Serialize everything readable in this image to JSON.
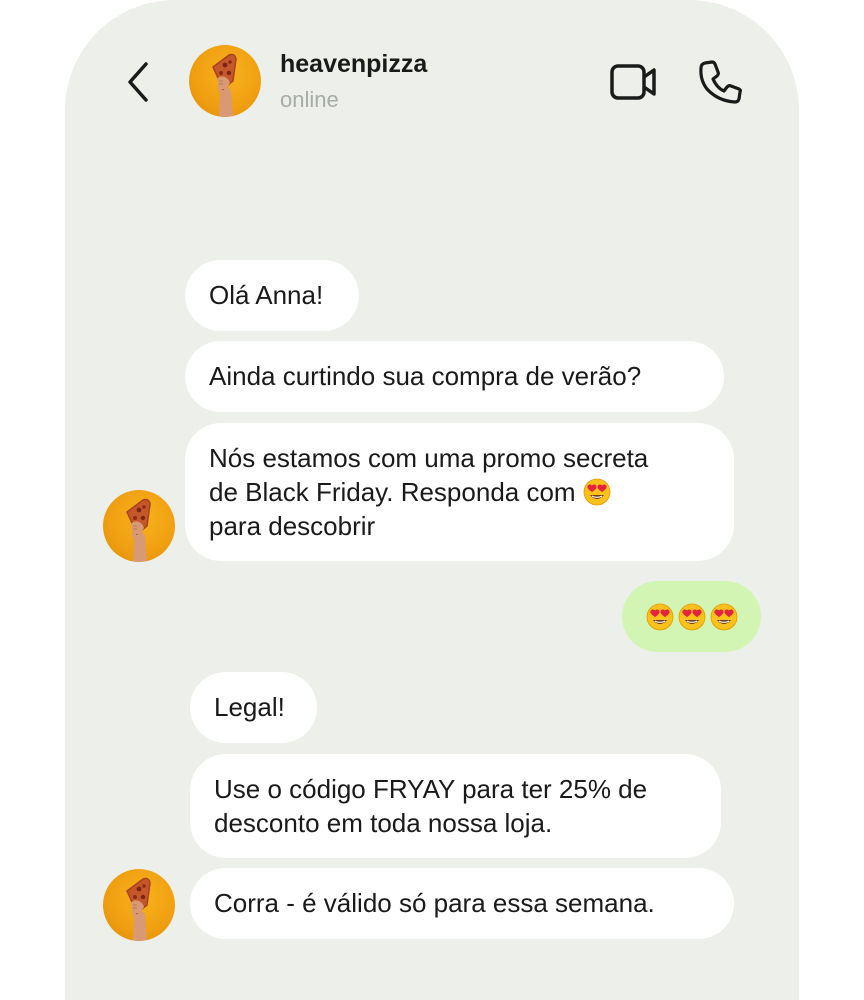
{
  "header": {
    "contact_name": "heavenpizza",
    "status": "online",
    "avatar_icon": "pizza-hand-icon"
  },
  "colors": {
    "background": "#edf0ea",
    "received_bubble": "#ffffff",
    "sent_bubble": "#d3f5b4",
    "avatar_bg": "#f0a011",
    "status_text": "#a8aca6"
  },
  "messages": [
    {
      "from": "heavenpizza",
      "text": "Olá Anna!"
    },
    {
      "from": "heavenpizza",
      "text": "Ainda curtindo sua compra de verão?"
    },
    {
      "from": "heavenpizza",
      "text_before_emoji": "Nós estamos com uma promo secreta\nde Black Friday. Responda com ",
      "emoji": "heart-eyes-emoji",
      "text_after_emoji": "\npara descobrir"
    },
    {
      "from": "me",
      "emojis": [
        "heart-eyes-emoji",
        "heart-eyes-emoji",
        "heart-eyes-emoji"
      ]
    },
    {
      "from": "heavenpizza",
      "text": "Legal!"
    },
    {
      "from": "heavenpizza",
      "text": "Use o código FRYAY para ter 25% de\ndesconto em toda nossa loja."
    },
    {
      "from": "heavenpizza",
      "text": "Corra - é válido só para essa semana."
    }
  ]
}
